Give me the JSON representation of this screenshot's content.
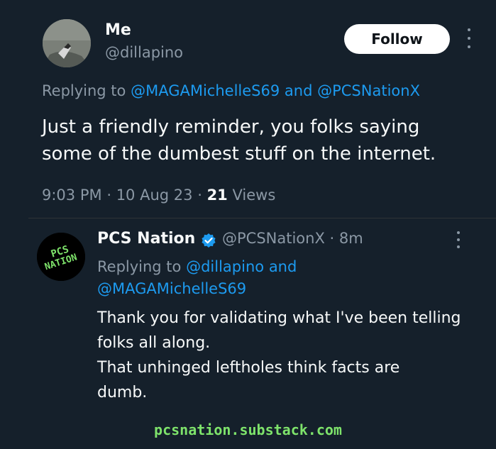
{
  "tweet": {
    "author": {
      "display_name": "Me",
      "handle": "@dillapino"
    },
    "follow_label": "Follow",
    "replying_prefix": "Replying to",
    "replying_to_1": "@MAGAMichelleS69",
    "replying_conjunction": "and",
    "replying_to_2": "@PCSNationX",
    "text_line1": "Just a friendly reminder, you folks saying",
    "text_line2": "some of the dumbest stuff on the internet.",
    "time": "9:03 PM",
    "date": "10 Aug 23",
    "views_count": "21",
    "views_label": "Views"
  },
  "reply": {
    "author": {
      "display_name": "PCS Nation",
      "handle": "@PCSNationX",
      "age": "8m",
      "avatar_text": "PCS NATION"
    },
    "replying_prefix": "Replying to",
    "replying_to_1": "@dillapino",
    "replying_conjunction": "and",
    "replying_to_2": "@MAGAMichelleS69",
    "lines": [
      "Thank you for validating what I've been telling",
      "folks all along.",
      "That unhinged leftholes think facts are",
      "dumb."
    ]
  },
  "watermark": "pcsnation.substack.com",
  "colors": {
    "background": "#15202b",
    "link": "#1d9bf0",
    "secondary_text": "#8b98a5",
    "watermark": "#7ee36b",
    "verified_badge": "#1d9bf0"
  },
  "icons": {
    "more": "more-vertical-icon",
    "verified": "verified-badge-icon"
  }
}
